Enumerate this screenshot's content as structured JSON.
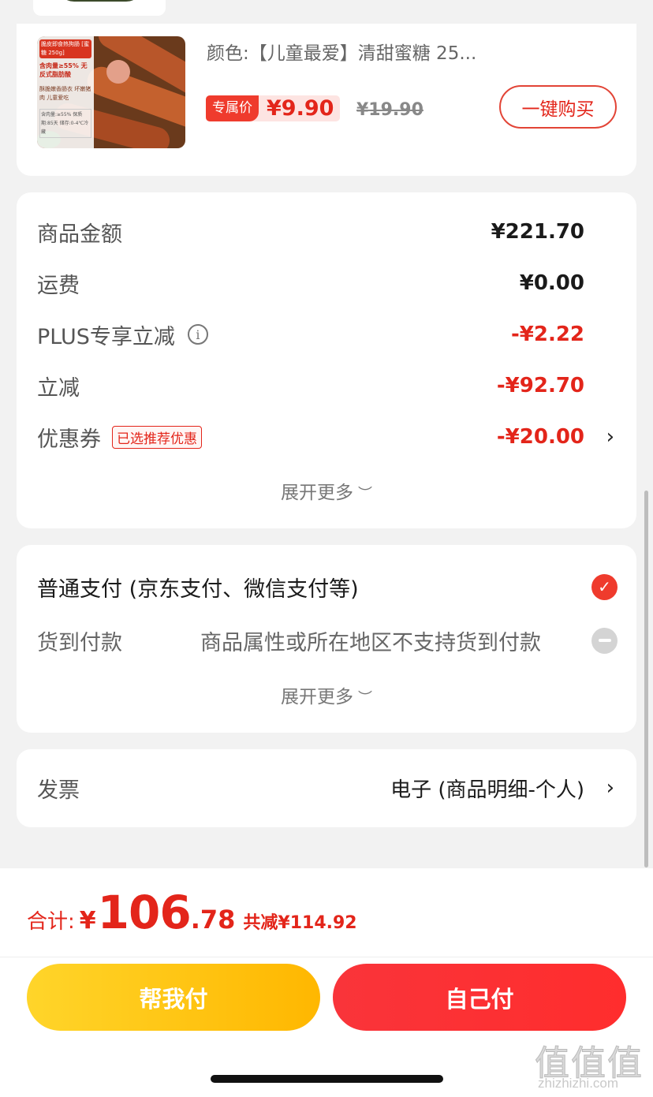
{
  "product": {
    "spec": "颜色:【儿童最爱】清甜蜜糖 25...",
    "exclusive_tag": "专属价",
    "exclusive_price": "¥9.90",
    "original_price": "¥19.90",
    "buy_button": "一键购买",
    "image_text": {
      "badge": "脆皮即食热狗肠 [蜜糖 250g]",
      "headline": "含肉量≥55% 无反式脂肪酸",
      "desc": "酥脆嫩香肠衣 坏嫩猪肉 儿童爱吃",
      "info": "含肉量:≥55% 保质期:85天 储存:0-4℃冷藏"
    }
  },
  "price_summary": {
    "rows": [
      {
        "label": "商品金额",
        "value": "¥221.70"
      },
      {
        "label": "运费",
        "value": "¥0.00"
      },
      {
        "label": "PLUS专享立减",
        "value": "-¥2.22"
      },
      {
        "label": "立减",
        "value": "-¥92.70"
      },
      {
        "label": "优惠券",
        "badge": "已选推荐优惠",
        "value": "-¥20.00"
      }
    ],
    "expand_more": "展开更多"
  },
  "payment": {
    "normal": "普通支付 (京东支付、微信支付等)",
    "cod_label": "货到付款",
    "cod_note": "商品属性或所在地区不支持货到付款",
    "expand_more": "展开更多"
  },
  "invoice": {
    "label": "发票",
    "value": "电子 (商品明细-个人)"
  },
  "footer": {
    "total_label": "合计:",
    "currency": "¥",
    "total_int": "106",
    "total_dec": ".78",
    "saved": "共减¥114.92",
    "help_pay": "帮我付",
    "self_pay": "自己付"
  },
  "watermark": {
    "big": "值值值",
    "small": "zhizhizhi.com"
  },
  "colors": {
    "accent_red": "#e3251a",
    "button_red": "#f9343a",
    "button_yellow": "#ffc21a"
  }
}
